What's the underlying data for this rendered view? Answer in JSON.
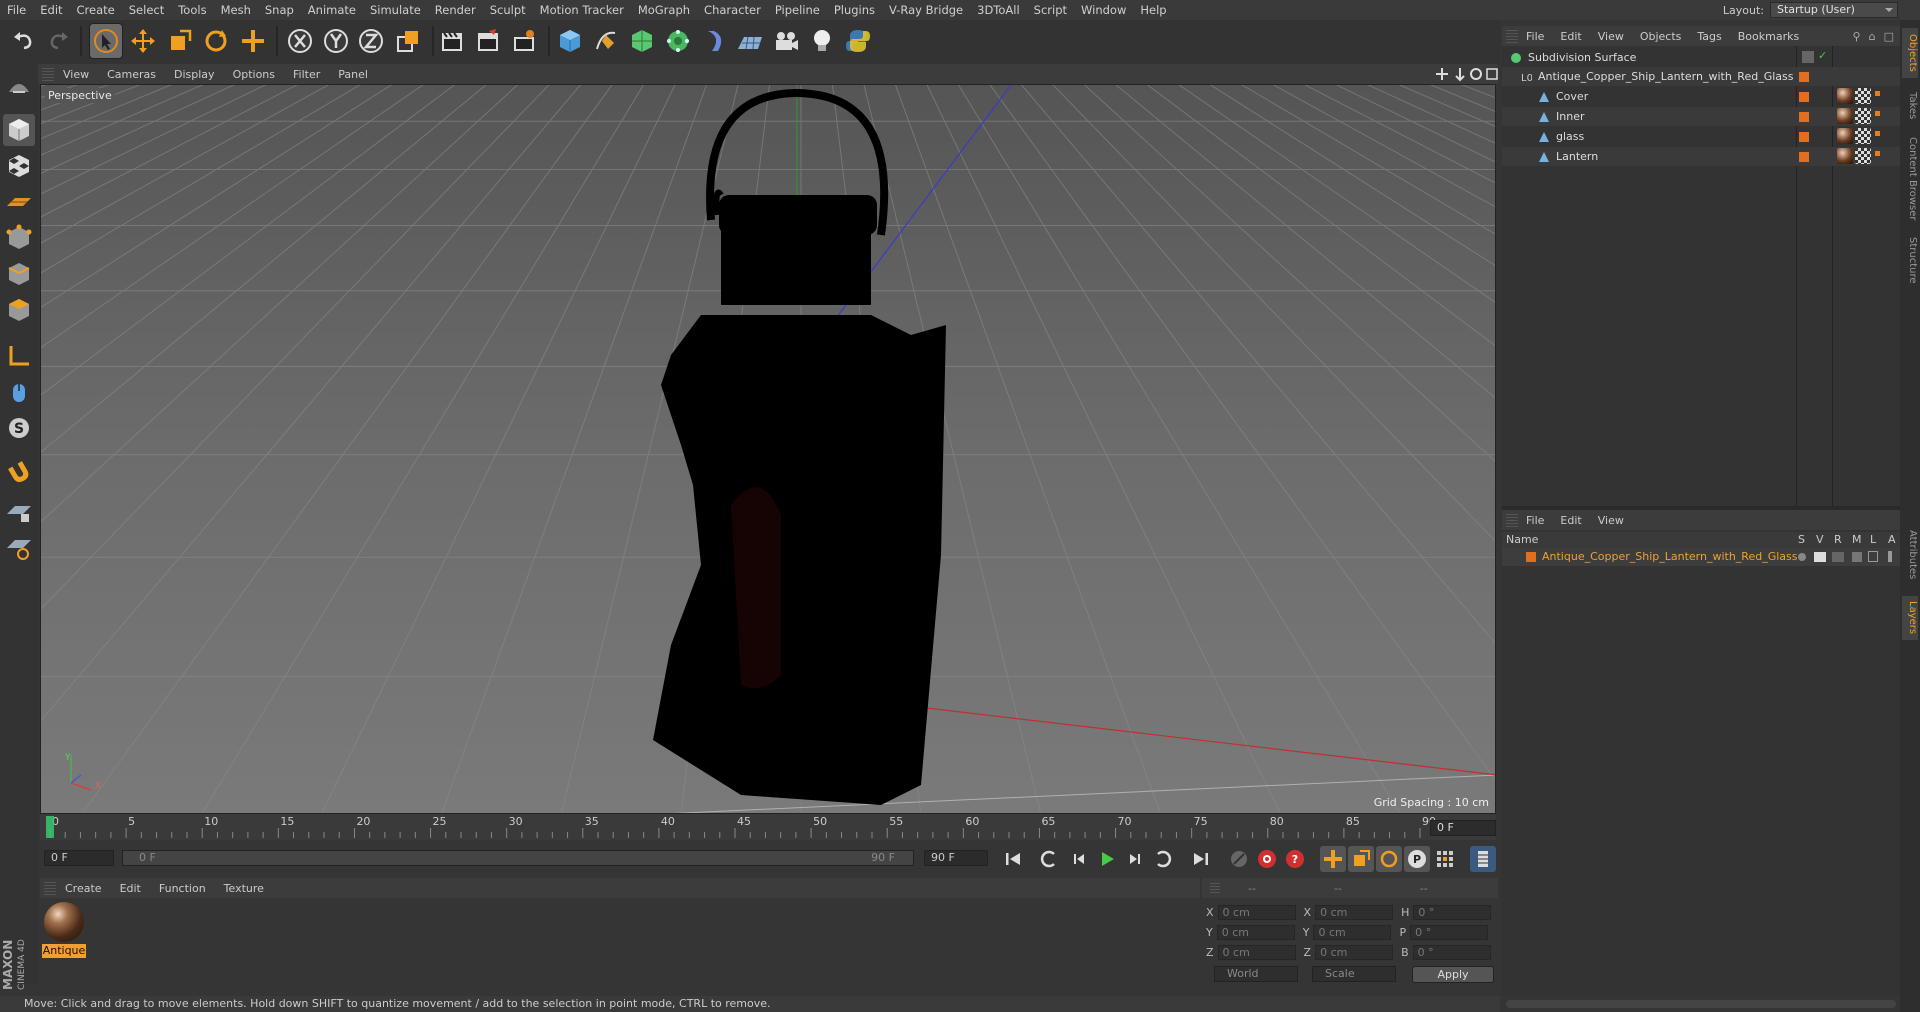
{
  "menubar": {
    "items": [
      "File",
      "Edit",
      "Create",
      "Select",
      "Tools",
      "Mesh",
      "Snap",
      "Animate",
      "Simulate",
      "Render",
      "Sculpt",
      "Motion Tracker",
      "MoGraph",
      "Character",
      "Pipeline",
      "Plugins",
      "V-Ray Bridge",
      "3DToAll",
      "Script",
      "Window",
      "Help"
    ],
    "layout_label": "Layout:",
    "layout_value": "Startup (User)"
  },
  "viewport": {
    "menu": [
      "View",
      "Cameras",
      "Display",
      "Options",
      "Filter",
      "Panel"
    ],
    "label": "Perspective",
    "grid_spacing": "Grid Spacing : 10 cm",
    "axis_y": "Y",
    "axis_x": "X"
  },
  "timeline": {
    "ticks": [
      "0",
      "5",
      "10",
      "15",
      "20",
      "25",
      "30",
      "35",
      "40",
      "45",
      "50",
      "55",
      "60",
      "65",
      "70",
      "75",
      "80",
      "85",
      "90"
    ],
    "current_frame": "0 F",
    "start_field": "0 F",
    "range_start": "0 F",
    "range_end": "90 F",
    "end_field": "90 F"
  },
  "material_manager": {
    "menu": [
      "Create",
      "Edit",
      "Function",
      "Texture"
    ],
    "materials": [
      {
        "label": "Antique"
      }
    ]
  },
  "coordinates": {
    "rows": [
      {
        "a": "X",
        "av": "0 cm",
        "b": "X",
        "bv": "0 cm",
        "c": "H",
        "cv": "0 °"
      },
      {
        "a": "Y",
        "av": "0 cm",
        "b": "Y",
        "bv": "0 cm",
        "c": "P",
        "cv": "0 °"
      },
      {
        "a": "Z",
        "av": "0 cm",
        "b": "Z",
        "bv": "0 cm",
        "c": "B",
        "cv": "0 °"
      }
    ],
    "mode_select": "World",
    "size_select": "Scale",
    "apply": "Apply",
    "header_dashes": [
      "--",
      "--",
      "--"
    ]
  },
  "status": {
    "text": "Move: Click and drag to move elements. Hold down SHIFT to quantize movement / add to the selection in point mode, CTRL to remove."
  },
  "object_manager": {
    "menu": [
      "File",
      "Edit",
      "View",
      "Objects",
      "Tags",
      "Bookmarks"
    ],
    "objects": [
      {
        "name": "Subdivision Surface",
        "indent": 0
      },
      {
        "name": "Antique_Copper_Ship_Lantern_with_Red_Glass",
        "indent": 1
      },
      {
        "name": "Cover",
        "indent": 2
      },
      {
        "name": "Inner",
        "indent": 2
      },
      {
        "name": "glass",
        "indent": 2
      },
      {
        "name": "Lantern",
        "indent": 2
      }
    ]
  },
  "layer_manager": {
    "menu": [
      "File",
      "Edit",
      "View"
    ],
    "columns": [
      "Name",
      "S",
      "V",
      "R",
      "M",
      "L",
      "A"
    ],
    "layers": [
      {
        "name": "Antique_Copper_Ship_Lantern_with_Red_Glass"
      }
    ]
  },
  "right_tabs": [
    "Objects",
    "Takes",
    "Content Browser",
    "Structure",
    "Attributes",
    "Layers"
  ],
  "branding": {
    "maxon": "MAXON",
    "product": "CINEMA 4D"
  },
  "colors": {
    "accent": "#f0a030",
    "layer_text": "#f0a030",
    "object_dot": "#e07020"
  }
}
